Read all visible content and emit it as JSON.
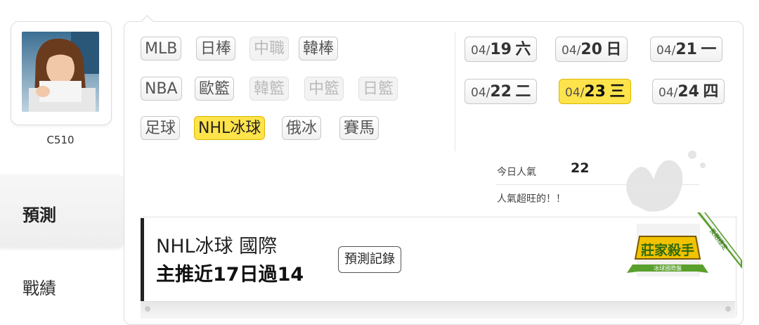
{
  "user": {
    "name": "C510"
  },
  "sidebar": {
    "tabs": [
      {
        "label": "預測"
      },
      {
        "label": "戰績"
      }
    ]
  },
  "sports": [
    [
      {
        "label": "MLB",
        "state": "normal"
      },
      {
        "label": "日棒",
        "state": "normal"
      },
      {
        "label": "中職",
        "state": "disabled"
      },
      {
        "label": "韓棒",
        "state": "normal"
      }
    ],
    [
      {
        "label": "NBA",
        "state": "normal"
      },
      {
        "label": "歐籃",
        "state": "normal"
      },
      {
        "label": "韓籃",
        "state": "disabled"
      },
      {
        "label": "中籃",
        "state": "disabled"
      },
      {
        "label": "日籃",
        "state": "disabled"
      }
    ],
    [
      {
        "label": "足球",
        "state": "normal"
      },
      {
        "label": "NHL冰球",
        "state": "active"
      },
      {
        "label": "俄冰",
        "state": "normal"
      },
      {
        "label": "賽馬",
        "state": "normal"
      }
    ]
  ],
  "dates": [
    {
      "month": "04/",
      "day": "19",
      "weekday": "六",
      "state": "normal"
    },
    {
      "month": "04/",
      "day": "20",
      "weekday": "日",
      "state": "normal"
    },
    {
      "month": "04/",
      "day": "21",
      "weekday": "一",
      "state": "normal"
    },
    {
      "month": "04/",
      "day": "22",
      "weekday": "二",
      "state": "normal"
    },
    {
      "month": "04/",
      "day": "23",
      "weekday": "三",
      "state": "active"
    },
    {
      "month": "04/",
      "day": "24",
      "weekday": "四",
      "state": "normal"
    }
  ],
  "popularity": {
    "label": "今日人氣",
    "value": "22",
    "note": "人氣超旺的！！"
  },
  "prediction": {
    "title": "NHL冰球 國際",
    "subtitle": "主推近17日過14",
    "record_button": "預測記錄"
  },
  "badge": {
    "ribbon": "長期穩定",
    "main": "莊家殺手",
    "sub": "冰球國際盤"
  },
  "colors": {
    "active": "#ffe34a",
    "badge_green": "#5aa02c",
    "badge_gold": "#f2c200"
  }
}
